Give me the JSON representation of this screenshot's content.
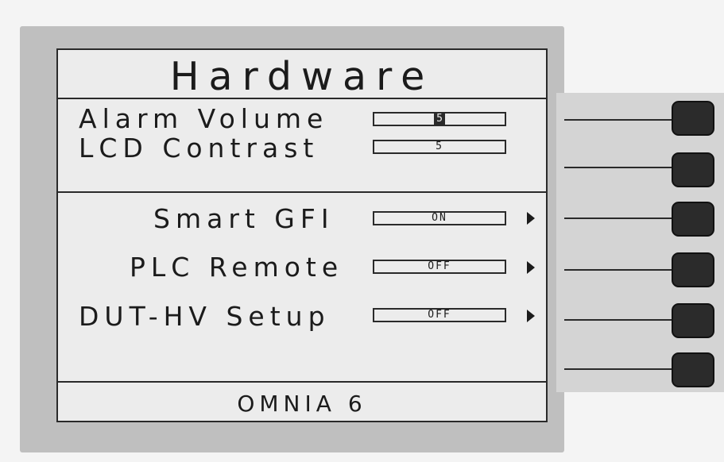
{
  "screen": {
    "title": "Hardware",
    "alarm_volume": {
      "label": "Alarm Volume",
      "value": "5"
    },
    "lcd_contrast": {
      "label": "LCD Contrast",
      "value": "5"
    },
    "smart_gfi": {
      "label": "Smart GFI",
      "value": "ON"
    },
    "plc_remote": {
      "label": "PLC Remote",
      "value": "OFF"
    },
    "dut_hv_setup": {
      "label": "DUT-HV Setup",
      "value": "OFF"
    },
    "footer": "OMNIA 6"
  }
}
